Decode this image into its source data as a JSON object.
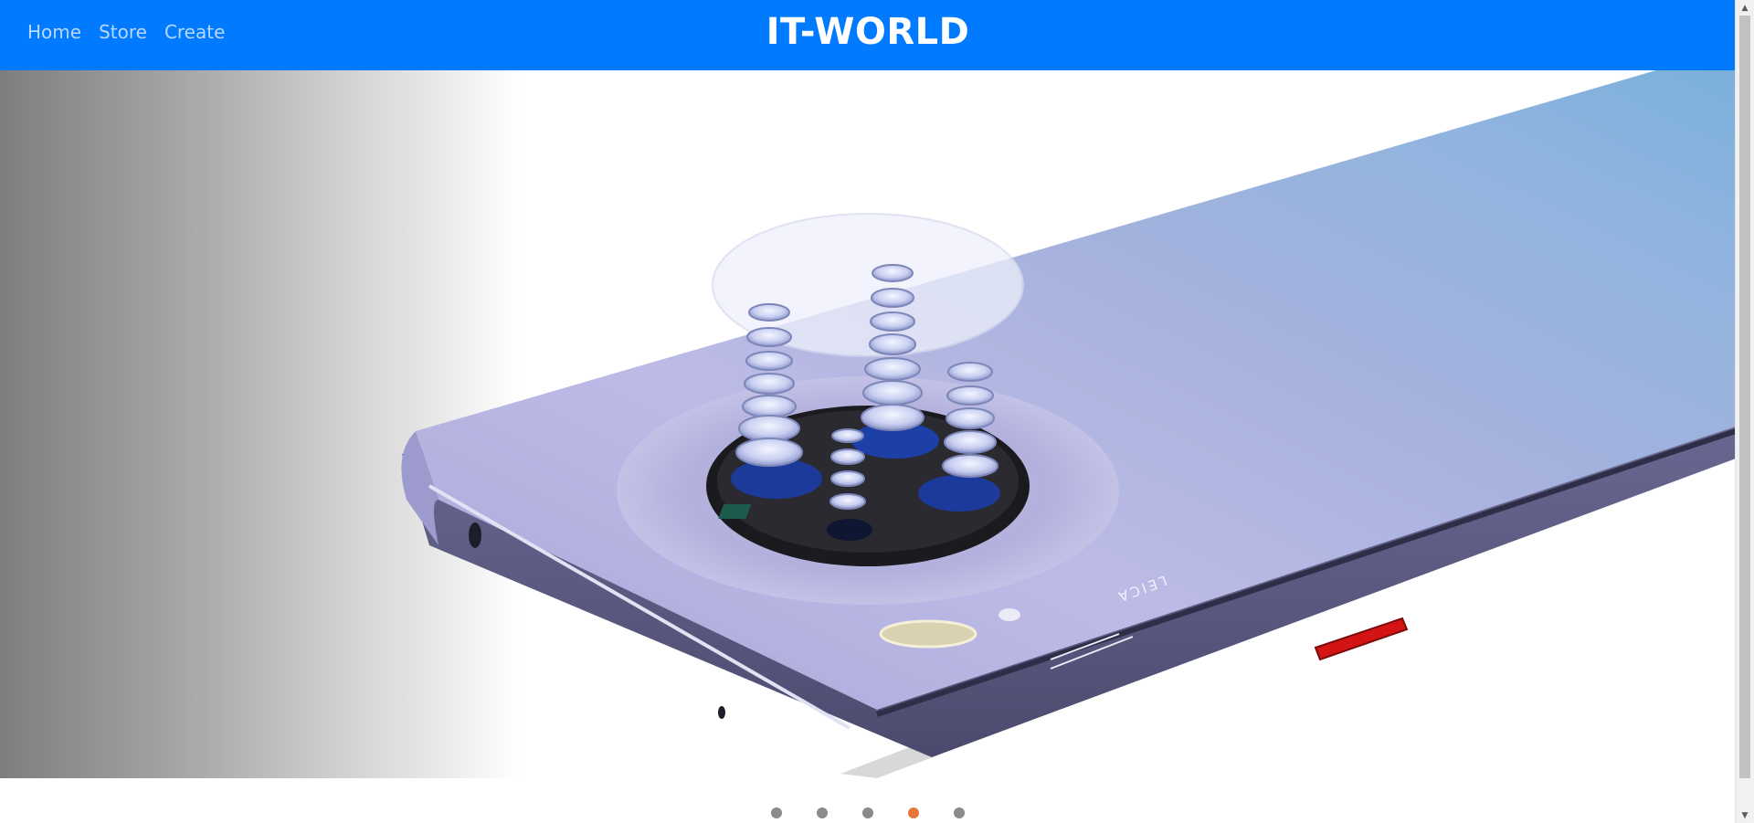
{
  "header": {
    "brand": "IT-WORLD",
    "nav": [
      {
        "label": "Home"
      },
      {
        "label": "Store"
      },
      {
        "label": "Create"
      }
    ],
    "background_color": "#007bff"
  },
  "carousel": {
    "slide_count": 5,
    "active_index": 3,
    "active_indicator_color": "#e8763a",
    "inactive_indicator_color": "#8a8a8a",
    "slide_image_icon": "phone-camera-render",
    "phone_engraving": "LEICA"
  },
  "scrollbar": {
    "up_arrow": "▲",
    "down_arrow": "▼"
  }
}
